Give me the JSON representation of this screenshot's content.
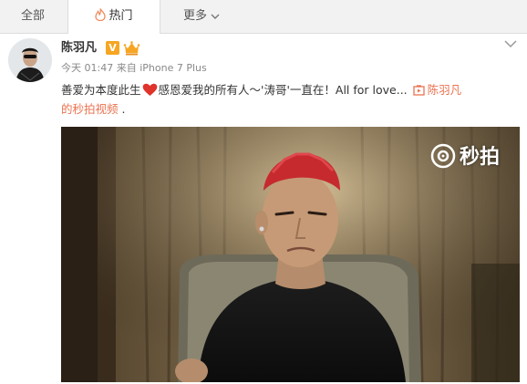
{
  "tabs": {
    "all": "全部",
    "hot": "热门",
    "more": "更多"
  },
  "post": {
    "author": "陈羽凡",
    "verified_badge": "V",
    "time": "今天 01:47",
    "source_prefix": "来自",
    "source": "iPhone 7 Plus",
    "text_part1": "善爱为本度此生",
    "text_part2": "感恩爱我的所有人～'涛哥'一直在！All for love...",
    "video_link_part1": "陈羽凡",
    "video_link_part2": "的秒拍视频",
    "trailing": " ."
  },
  "video": {
    "watermark": "秒拍"
  },
  "colors": {
    "accent": "#eb7350",
    "verified": "#f6a623",
    "heart": "#e0332b"
  }
}
